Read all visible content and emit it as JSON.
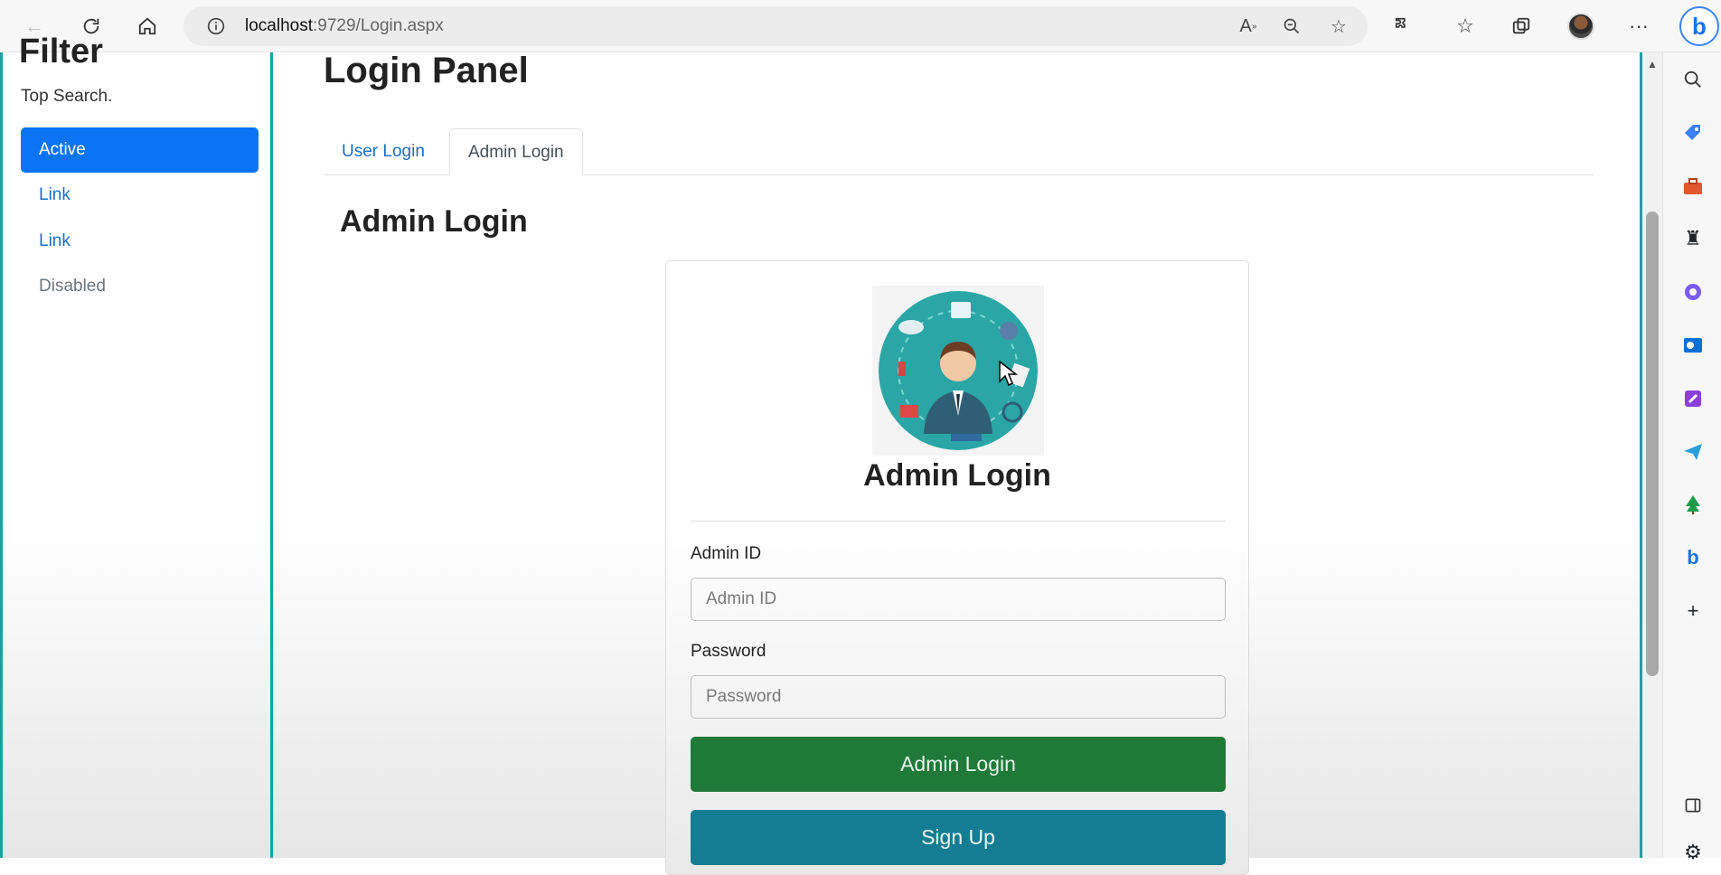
{
  "browser": {
    "url_host": "localhost",
    "url_rest": ":9729/Login.aspx",
    "icons": [
      "back-icon",
      "refresh-icon",
      "home-icon",
      "info-icon",
      "read-aloud-icon",
      "zoom-out-icon",
      "add-favorite-icon",
      "extensions-icon",
      "favorites-icon",
      "collections-icon",
      "profile-avatar",
      "more-icon",
      "bing-copilot-icon"
    ]
  },
  "sidebar": {
    "title": "Filter",
    "subtitle": "Top Search.",
    "items": [
      {
        "label": "Active",
        "state": "active"
      },
      {
        "label": "Link",
        "state": "normal"
      },
      {
        "label": "Link",
        "state": "normal"
      },
      {
        "label": "Disabled",
        "state": "disabled"
      }
    ]
  },
  "main": {
    "page_title": "Login Panel",
    "tabs": [
      {
        "label": "User Login",
        "active": false
      },
      {
        "label": "Admin Login",
        "active": true
      }
    ],
    "section_title": "Admin Login"
  },
  "login_card": {
    "title": "Admin Login",
    "admin_id_label": "Admin ID",
    "admin_id_placeholder": "Admin ID",
    "admin_id_value": "",
    "password_label": "Password",
    "password_placeholder": "Password",
    "password_value": "",
    "login_button": "Admin Login",
    "signup_button": "Sign Up"
  },
  "edge_sidebar": {
    "icons": [
      "search-icon",
      "shopping-tag-icon",
      "tools-icon",
      "games-icon",
      "microsoft365-icon",
      "outlook-icon",
      "designer-icon",
      "telegram-icon",
      "tree-icon",
      "bing-icon",
      "add-icon",
      "split-screen-icon",
      "settings-icon"
    ]
  },
  "colors": {
    "accent_blue": "#0a74f5",
    "link_blue": "#1a6fc4",
    "teal_border": "#17a2a2",
    "login_green": "#1f7a37",
    "signup_teal": "#157d93"
  }
}
